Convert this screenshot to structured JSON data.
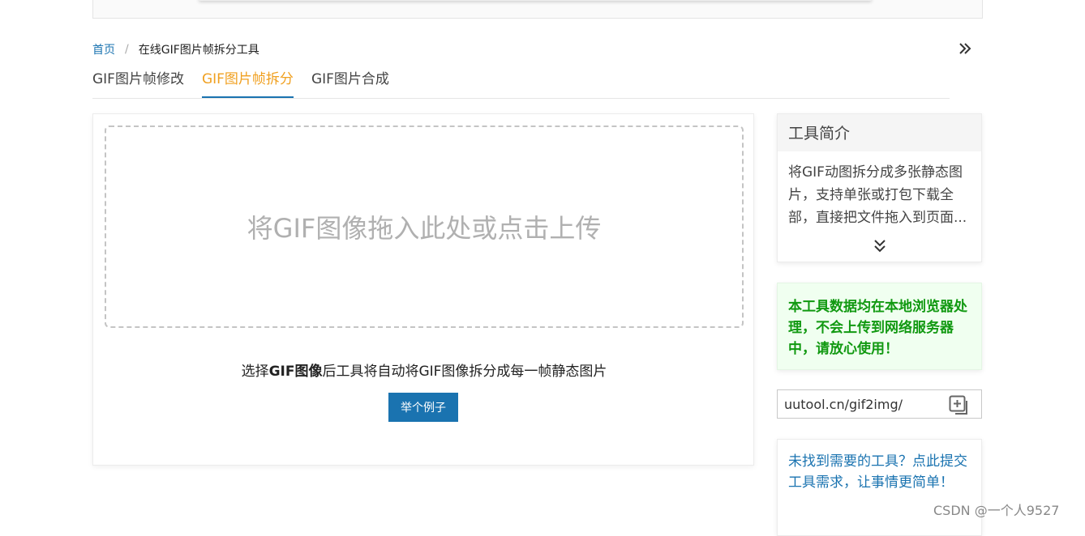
{
  "breadcrumb": {
    "home": "首页",
    "separator": "/",
    "current": "在线GIF图片帧拆分工具"
  },
  "tabs": [
    {
      "label": "GIF图片帧修改",
      "active": false
    },
    {
      "label": "GIF图片帧拆分",
      "active": true
    },
    {
      "label": "GIF图片合成",
      "active": false
    }
  ],
  "main": {
    "dropzone_text": "将GIF图像拖入此处或点击上传",
    "instruction_prefix": "选择",
    "instruction_bold": "GIF图像",
    "instruction_suffix": "后工具将自动将GIF图像拆分成每一帧静态图片",
    "example_button": "举个例子"
  },
  "sidebar": {
    "intro_title": "工具简介",
    "intro_text": "将GIF动图拆分成多张静态图片，支持单张或打包下载全部，直接把文件拖入到页面...",
    "notice": "本工具数据均在本地浏览器处理，不会上传到网络服务器中，请放心使用！",
    "url": "uutool.cn/gif2img/",
    "request_link": "未找到需要的工具？点此提交工具需求，让事情更简单！"
  },
  "watermark": "CSDN @一个人9527",
  "icons": {
    "expand": "double-chevron-right-icon",
    "more": "double-chevron-down-icon",
    "copy": "copy-icon"
  },
  "colors": {
    "accent": "#1a73b0",
    "active_tab": "#f0a020",
    "notice_text": "#119911",
    "notice_bg": "#f0fff0"
  }
}
